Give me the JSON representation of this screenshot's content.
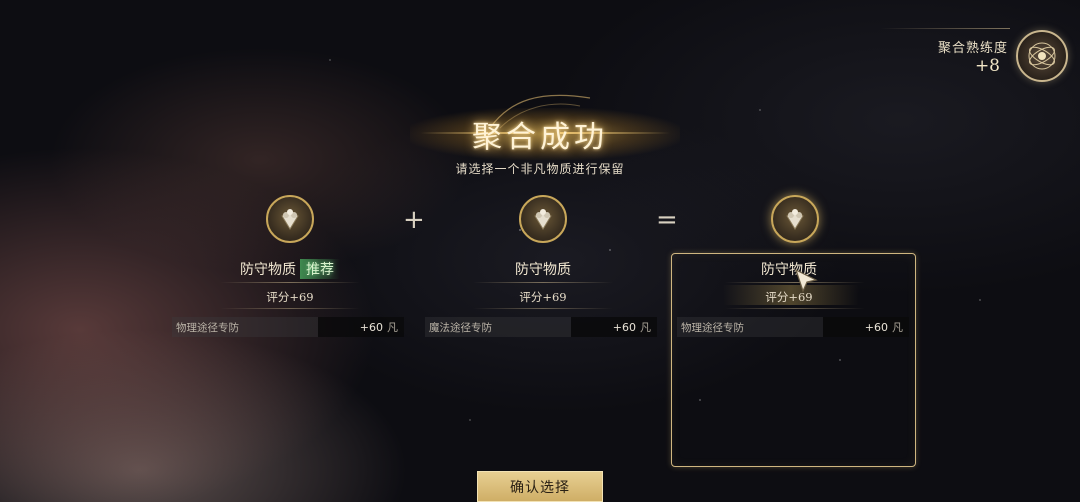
{
  "proficiency": {
    "label": "聚合熟练度",
    "value": "+8"
  },
  "title": "聚合成功",
  "subtitle": "请选择一个非凡物质进行保留",
  "operators": {
    "plus": "+",
    "equals": "="
  },
  "cards": [
    {
      "name": "防守物质",
      "badge": "推荐",
      "score": "评分+69",
      "stat_label": "物理途径专防",
      "stat_value": "+60",
      "stat_unit": "凡"
    },
    {
      "name": "防守物质",
      "score": "评分+69",
      "stat_label": "魔法途径专防",
      "stat_value": "+60",
      "stat_unit": "凡"
    },
    {
      "name": "防守物质",
      "score": "评分+69",
      "stat_label": "物理途径专防",
      "stat_value": "+60",
      "stat_unit": "凡",
      "selected": true
    }
  ],
  "confirm_label": "确认选择",
  "colors": {
    "gold": "#cfb680",
    "recommend_green": "#46a05a",
    "button": "#dcbf7c"
  }
}
